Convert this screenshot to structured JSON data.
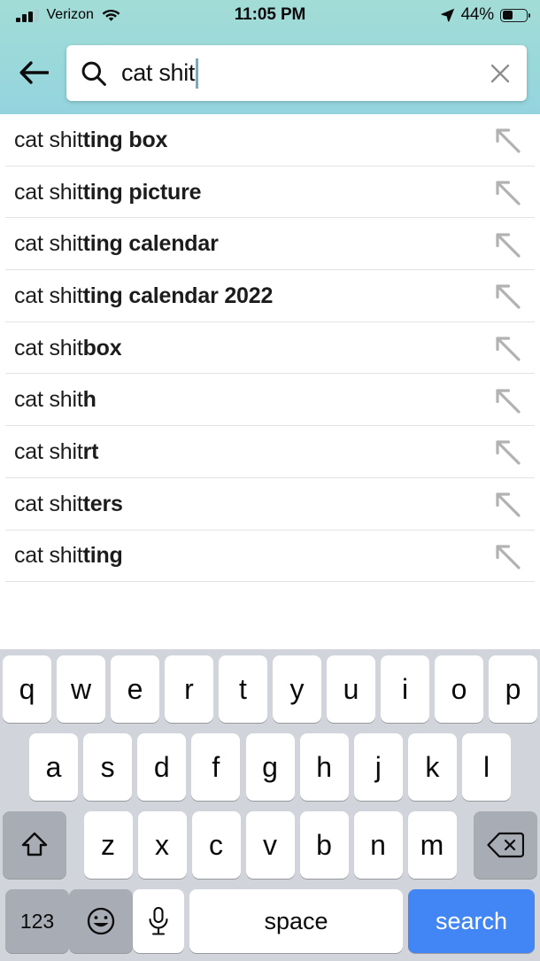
{
  "status_bar": {
    "carrier": "Verizon",
    "time": "11:05 PM",
    "battery_percent": "44%",
    "battery_level": 44,
    "signal_bars_filled": 3,
    "signal_bars_total": 4,
    "wifi_icon": "wifi-icon",
    "location_icon": "location-arrow-icon",
    "battery_icon": "battery-icon"
  },
  "search_bar": {
    "back_icon": "back-arrow-icon",
    "search_icon": "search-icon",
    "query": "cat shit",
    "placeholder": "Search",
    "clear_icon": "close-icon",
    "cursor_color": "#6aaecb",
    "background": "#ffffff"
  },
  "theme": {
    "header_gradient_top": "#a3dcd6",
    "header_gradient_bottom": "#94d4de",
    "keyboard_background": "#d1d4da",
    "key_white": "#ffffff",
    "key_gray": "#a8acb5",
    "accent_blue": "#4285f4",
    "row_divider": "#e3e3e3",
    "arrow_gray": "#b2b2b2"
  },
  "suggestions": {
    "prefix": "cat shit",
    "arrow_icon": "arrow-up-left-icon",
    "items": [
      {
        "prefix": "cat shit",
        "completion": "ting box"
      },
      {
        "prefix": "cat shit",
        "completion": "ting picture"
      },
      {
        "prefix": "cat shit",
        "completion": "ting calendar"
      },
      {
        "prefix": "cat shit",
        "completion": "ting calendar 2022"
      },
      {
        "prefix": "cat shit",
        "completion": "box"
      },
      {
        "prefix": "cat shit",
        "completion": "h"
      },
      {
        "prefix": "cat shit",
        "completion": "rt"
      },
      {
        "prefix": "cat shit",
        "completion": "ters"
      },
      {
        "prefix": "cat shit",
        "completion": "ting"
      }
    ]
  },
  "keyboard": {
    "row1": [
      "q",
      "w",
      "e",
      "r",
      "t",
      "y",
      "u",
      "i",
      "o",
      "p"
    ],
    "row2": [
      "a",
      "s",
      "d",
      "f",
      "g",
      "h",
      "j",
      "k",
      "l"
    ],
    "row3": [
      "z",
      "x",
      "c",
      "v",
      "b",
      "n",
      "m"
    ],
    "shift_icon": "shift-arrow-icon",
    "backspace_icon": "backspace-icon",
    "numbers_label": "123",
    "emoji_icon": "emoji-smiley-icon",
    "mic_icon": "microphone-icon",
    "space_label": "space",
    "search_label": "search"
  }
}
